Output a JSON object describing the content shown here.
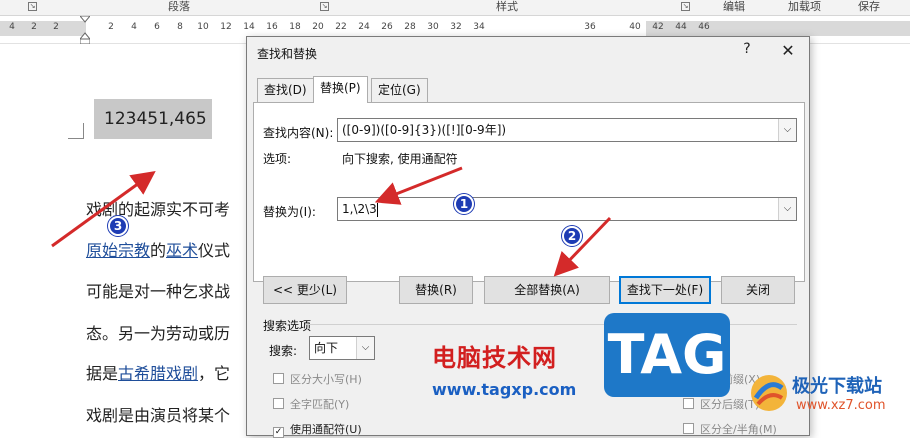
{
  "ribbon": {
    "groups": [
      "段落",
      "样式",
      "编辑",
      "加载项",
      "保存"
    ]
  },
  "ruler": {
    "numbers": [
      "4",
      "2",
      "2",
      "2",
      "4",
      "6",
      "8",
      "10",
      "12",
      "14",
      "16",
      "18",
      "20",
      "22",
      "24",
      "26",
      "28",
      "30",
      "32",
      "34",
      "36",
      "40",
      "42",
      "44",
      "46"
    ]
  },
  "document": {
    "highlighted_number": "123451,465",
    "lines": [
      {
        "text": "戏剧的起源实不可考"
      },
      {
        "link1": "原始宗教",
        "mid": "的",
        "link2": "巫术",
        "tail": "仪式"
      },
      {
        "text": "可能是对一种乞求战"
      },
      {
        "text": "态。另一为劳动或历"
      },
      {
        "pre": "据是",
        "link": "古希腊戏剧",
        "tail": "，它"
      },
      {
        "text": "戏剧是由演员将某个"
      }
    ]
  },
  "dialog": {
    "title": "查找和替换",
    "help": "?",
    "close": "✕",
    "tabs": [
      "查找(D)",
      "替换(P)",
      "定位(G)"
    ],
    "find_label": "查找内容(N):",
    "find_value": "([0-9])([0-9]{3})([!][0-9年])",
    "options_label": "选项:",
    "options_value": "向下搜索, 使用通配符",
    "replace_label": "替换为(I):",
    "replace_value": "1,\\2\\3",
    "buttons": {
      "less": "<< 更少(L)",
      "replace": "替换(R)",
      "replace_all": "全部替换(A)",
      "find_next": "查找下一处(F)",
      "close": "关闭"
    },
    "search_options_title": "搜索选项",
    "search_label": "搜索:",
    "search_value": "向下",
    "checkboxes": [
      "区分大小写(H)",
      "全字匹配(Y)",
      "使用通配符(U)"
    ],
    "right_checkboxes": [
      "区分前缀(X)",
      "区分后缀(T)",
      "区分全/半角(M)"
    ]
  },
  "annotations": [
    "1",
    "2",
    "3"
  ],
  "watermark": {
    "site_name": "电脑技术网",
    "site_url": "www.tagxp.com",
    "tag": "TAG",
    "logo_name": "极光下载站",
    "logo_url": "www.xz7.com"
  },
  "colors": {
    "arrow": "#d42a2a",
    "badge": "#1e3cb4",
    "link": "#1f4e9a",
    "focus": "#0078d7"
  }
}
